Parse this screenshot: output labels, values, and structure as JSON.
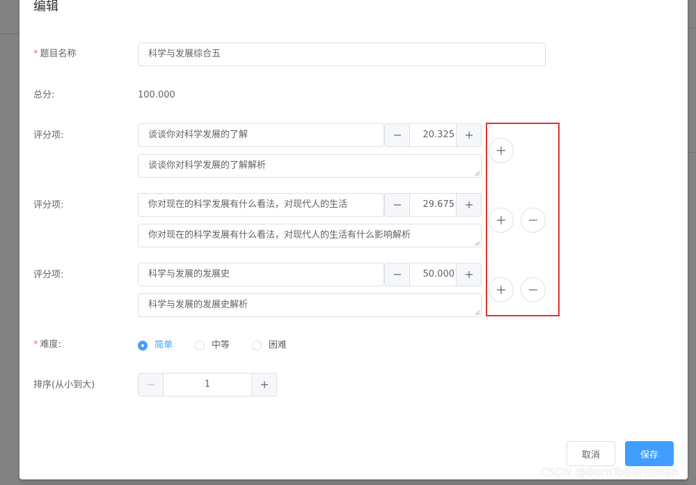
{
  "dialog": {
    "title": "编辑"
  },
  "form": {
    "name_label": "题目名称",
    "name_value": "科学与发展综合五",
    "total_label": "总分:",
    "total_value": "100.000",
    "score_item_label": "评分项:",
    "score_items": [
      {
        "title": "谈谈你对科学发展的了解",
        "score": "20.325",
        "analysis": "谈谈你对科学发展的了解解析"
      },
      {
        "title": "你对现在的科学发展有什么看法，对现代人的生活",
        "score": "29.675",
        "analysis": "你对现在的科学发展有什么看法，对现代人的生活有什么影响解析"
      },
      {
        "title": "科学与发展的发展史",
        "score": "50.000",
        "analysis": "科学与发展的发展史解析"
      }
    ],
    "difficulty_label": "难度:",
    "difficulty_options": [
      "简单",
      "中等",
      "困难"
    ],
    "difficulty_selected": "简单",
    "sort_label": "排序(从小到大)",
    "sort_value": "1"
  },
  "footer": {
    "cancel_label": "取消",
    "save_label": "保存"
  },
  "watermark": "CSDN @BornToBeHuman",
  "colors": {
    "primary": "#409eff",
    "required_star": "#f56c6c",
    "highlight_border": "#e4312b"
  },
  "icons": [
    "plus-icon",
    "minus-icon"
  ]
}
